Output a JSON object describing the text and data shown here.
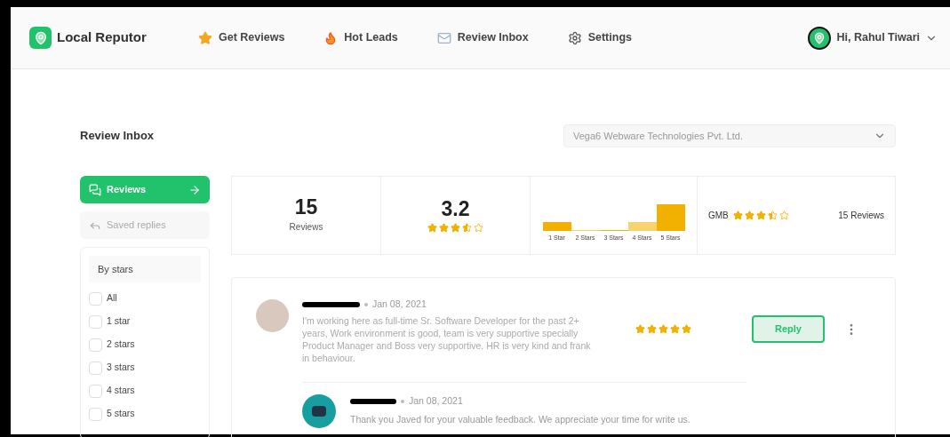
{
  "brand": {
    "name": "Local Reputor"
  },
  "nav": [
    {
      "kind": "star",
      "label": "Get Reviews"
    },
    {
      "kind": "fire",
      "label": "Hot Leads"
    },
    {
      "kind": "mail",
      "label": "Review Inbox"
    },
    {
      "kind": "gear",
      "label": "Settings"
    }
  ],
  "user": {
    "greeting": "Hi, Rahul Tiwari"
  },
  "page_title": "Review Inbox",
  "business_select": {
    "value": "Vega6 Webware Technologies Pvt. Ltd."
  },
  "sidebar": {
    "items": [
      {
        "kind": "reviews",
        "label": "Reviews",
        "selected": true
      },
      {
        "kind": "saved",
        "label": "Saved replies",
        "selected": false
      }
    ],
    "filter_title": "By stars",
    "filters": [
      {
        "label": "All",
        "checked": false
      },
      {
        "label": "1 star",
        "checked": false
      },
      {
        "label": "2 stars",
        "checked": false
      },
      {
        "label": "3 stars",
        "checked": false
      },
      {
        "label": "4 stars",
        "checked": false
      },
      {
        "label": "5 stars",
        "checked": false
      }
    ]
  },
  "stats": {
    "count": "15",
    "count_label": "Reviews",
    "average": "3.2",
    "stars": 3.5,
    "histogram_labels": [
      "1 Star",
      "2 Stars",
      "3 Stars",
      "4 Stars",
      "5 Stars"
    ],
    "source": {
      "name": "GMB",
      "stars": 3.5,
      "count": "15 Reviews"
    }
  },
  "reviews": [
    {
      "date": "Jan 08, 2021",
      "text": "I'm working here as full-time Sr. Software Developer for the past 2+ years, Work environment is good, team is very supportive specially Product Manager and Boss very supportive. HR is very kind and frank in behaviour.",
      "stars": 5,
      "button": "Reply",
      "reply": {
        "date": "Jan 08, 2021",
        "text": "Thank you Javed for your valuable feedback. We appreciate your time for write us."
      }
    }
  ]
}
